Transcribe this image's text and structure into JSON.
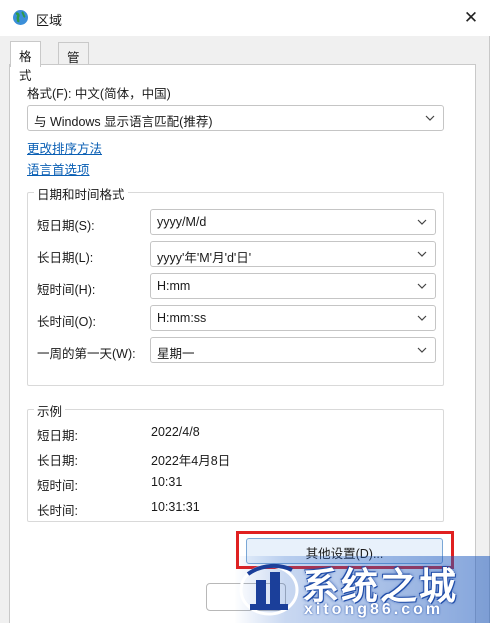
{
  "window": {
    "title": "区域",
    "icon": "globe-icon"
  },
  "tabs": [
    {
      "label": "格式",
      "active": true
    },
    {
      "label": "管理",
      "active": false
    }
  ],
  "format": {
    "label": "格式(F): 中文(简体，中国)",
    "select_value": "与 Windows 显示语言匹配(推荐)"
  },
  "links": {
    "sort": "更改排序方法",
    "language": "语言首选项"
  },
  "datetime": {
    "group_title": "日期和时间格式",
    "rows": [
      {
        "label": "短日期(S):",
        "value": "yyyy/M/d"
      },
      {
        "label": "长日期(L):",
        "value": "yyyy'年'M'月'd'日'"
      },
      {
        "label": "短时间(H):",
        "value": "H:mm"
      },
      {
        "label": "长时间(O):",
        "value": "H:mm:ss"
      },
      {
        "label": "一周的第一天(W):",
        "value": "星期一"
      }
    ]
  },
  "examples": {
    "group_title": "示例",
    "rows": [
      {
        "label": "短日期:",
        "value": "2022/4/8"
      },
      {
        "label": "长日期:",
        "value": "2022年4月8日"
      },
      {
        "label": "短时间:",
        "value": "10:31"
      },
      {
        "label": "长时间:",
        "value": "10:31:31"
      }
    ]
  },
  "buttons": {
    "other_settings": "其他设置(D)...",
    "ok": ""
  },
  "watermark": {
    "main": "系统之城",
    "sub": "xitong86.com"
  },
  "colors": {
    "link": "#0a5fb4",
    "highlight": "#e02020",
    "button_focus": "#e8f1fb"
  }
}
